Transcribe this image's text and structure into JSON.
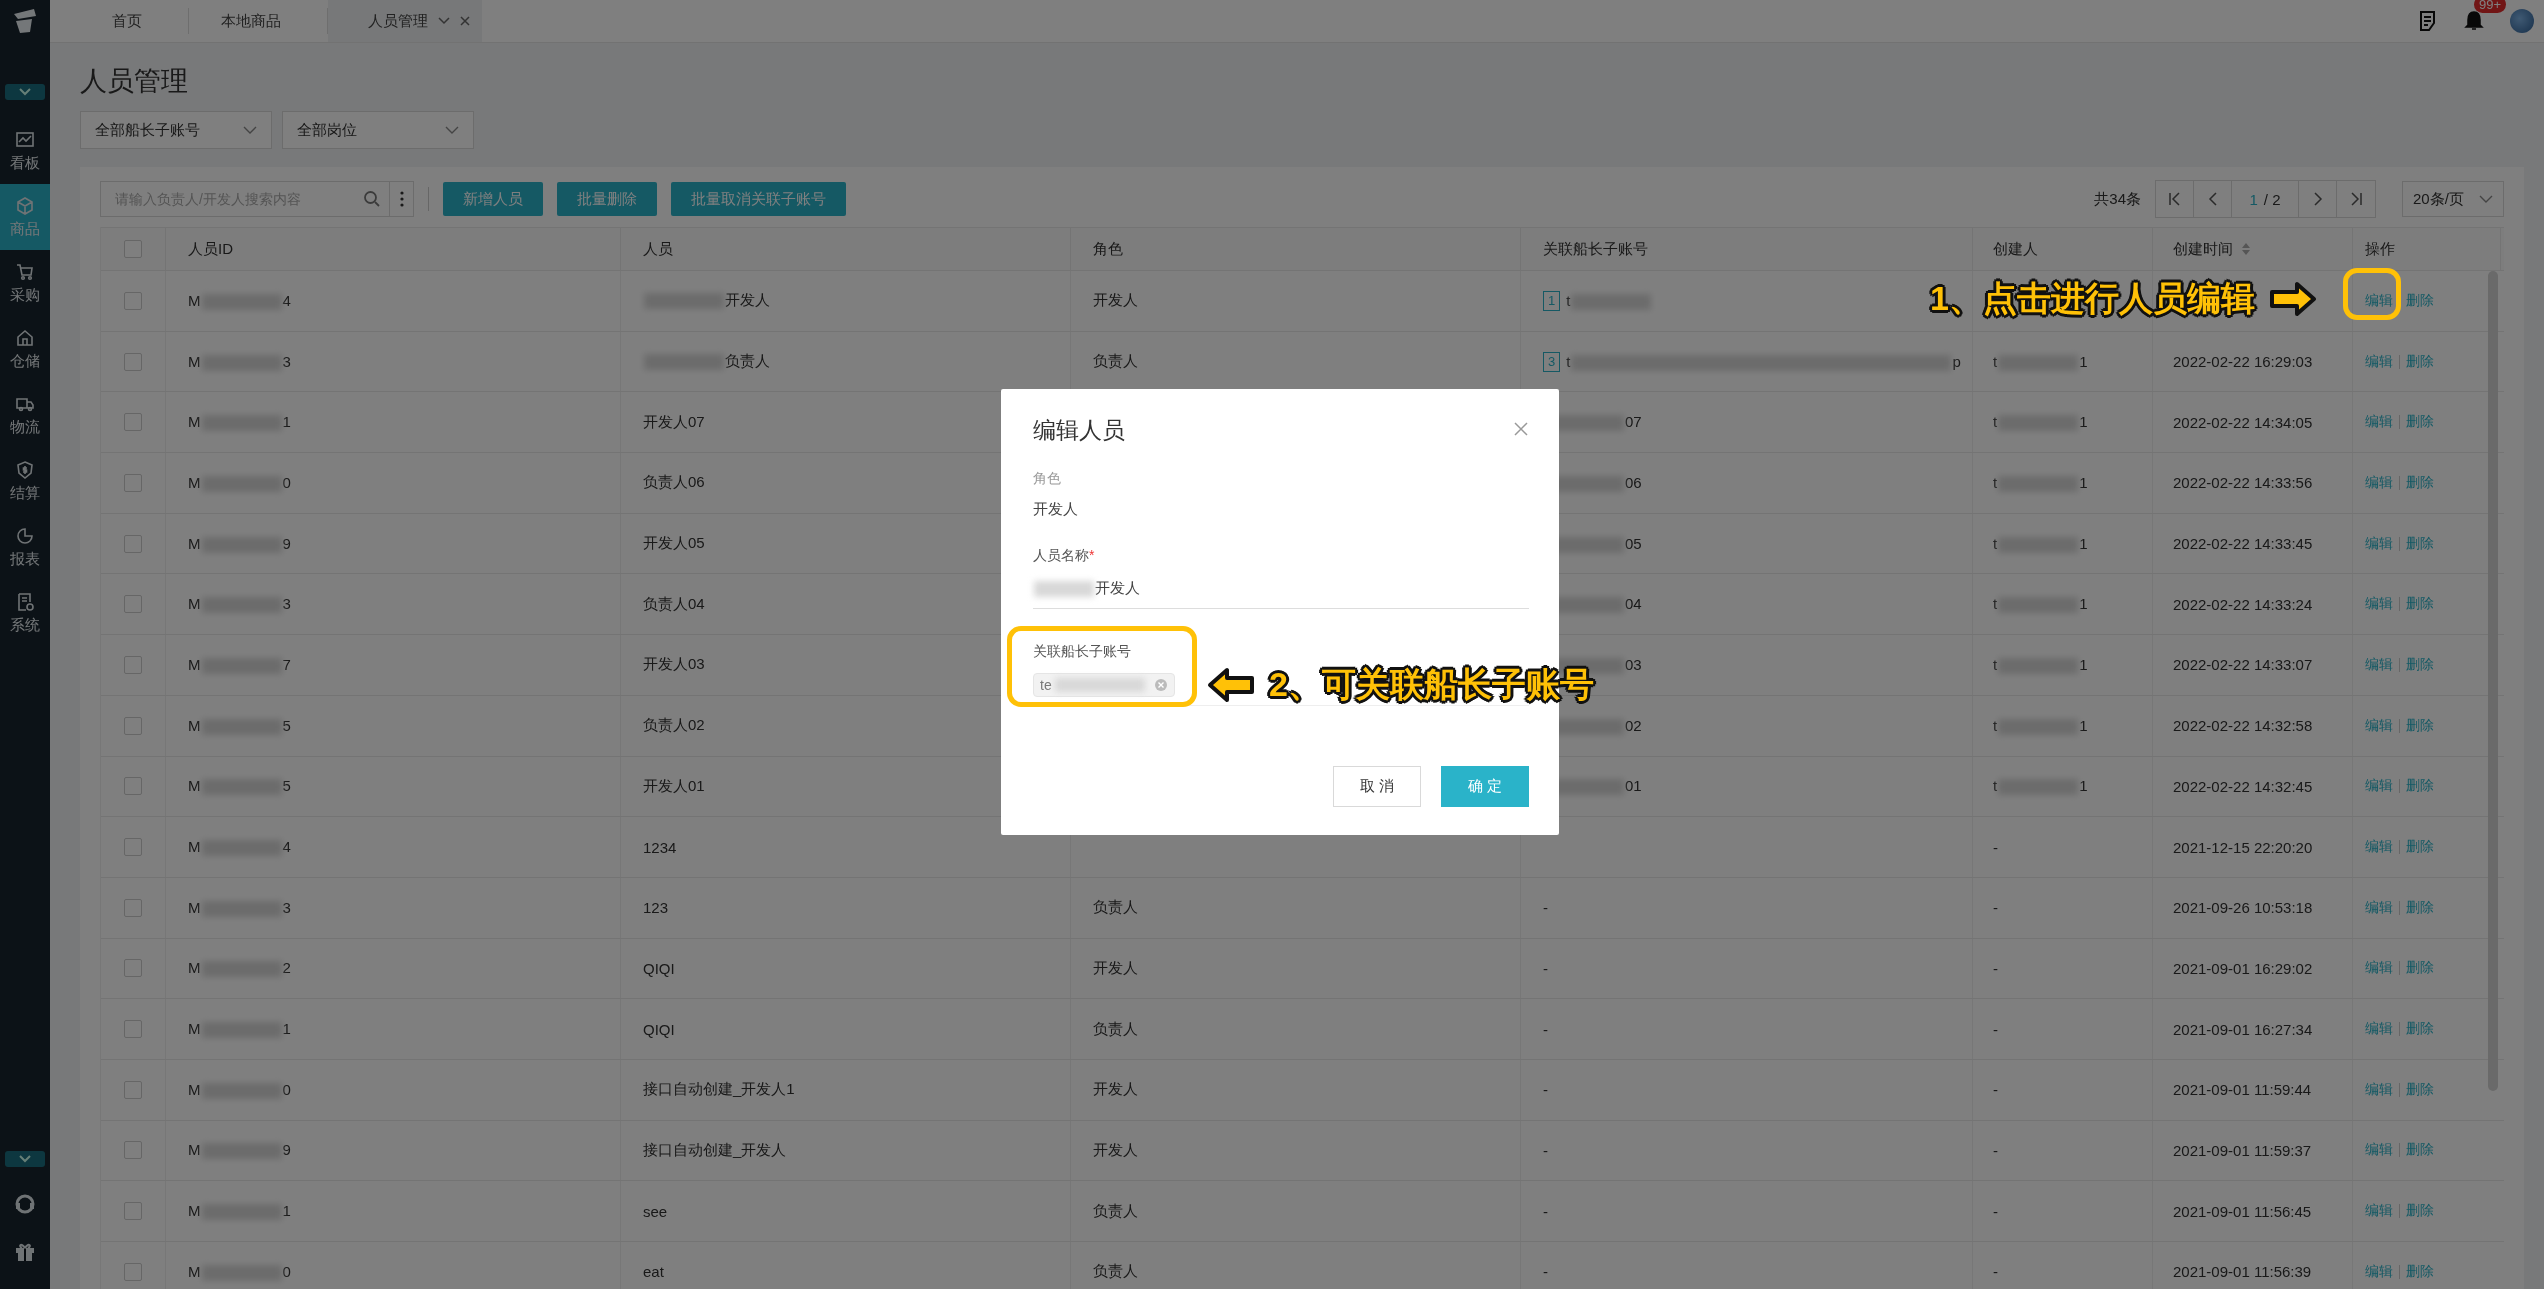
{
  "sidebar": {
    "items": [
      {
        "label": "看板",
        "selected": false
      },
      {
        "label": "商品",
        "selected": true
      },
      {
        "label": "采购",
        "selected": false
      },
      {
        "label": "仓储",
        "selected": false
      },
      {
        "label": "物流",
        "selected": false
      },
      {
        "label": "结算",
        "selected": false
      },
      {
        "label": "报表",
        "selected": false
      },
      {
        "label": "系统",
        "selected": false
      }
    ]
  },
  "tabs": [
    {
      "label": "首页",
      "selected": false
    },
    {
      "label": "本地商品",
      "selected": false
    },
    {
      "label": "人员管理",
      "selected": true
    }
  ],
  "header": {
    "notification_badge": "99+"
  },
  "page_title": "人员管理",
  "filters": [
    {
      "value": "全部船长子账号"
    },
    {
      "value": "全部岗位"
    }
  ],
  "search": {
    "placeholder": "请输入负责人/开发人搜索内容"
  },
  "actions": [
    "新增人员",
    "批量删除",
    "批量取消关联子账号"
  ],
  "pagination": {
    "total": "共34条",
    "current": "1",
    "pages": "/ 2",
    "page_size": "20条/页"
  },
  "table": {
    "select_all": false,
    "columns": [
      {
        "label": "人员ID"
      },
      {
        "label": "人员"
      },
      {
        "label": "角色"
      },
      {
        "label": "关联船长子账号"
      },
      {
        "label": "创建人"
      },
      {
        "label": "创建时间",
        "sortable": true
      },
      {
        "label": "操作"
      }
    ],
    "rows": [
      {
        "checked": false,
        "id": {
          "head": "M",
          "tail": "4"
        },
        "person": {
          "tail": "开发人"
        },
        "role": "开发人",
        "account": {
          "badge": "1",
          "head": "t"
        },
        "creator": null,
        "time": null,
        "actions": [
          "编辑",
          "删除"
        ]
      },
      {
        "checked": false,
        "id": {
          "head": "M",
          "tail": "3"
        },
        "person": {
          "tail": "负责人"
        },
        "role": "负责人",
        "account": {
          "badge": "3",
          "head": "t",
          "tail": "p"
        },
        "creator": {
          "head": "t",
          "tail": "1"
        },
        "time": "2022-02-22 16:29:03",
        "actions": [
          "编辑",
          "删除"
        ]
      },
      {
        "checked": false,
        "id": {
          "head": "M",
          "tail": "1"
        },
        "person": "开发人07",
        "role": null,
        "account": {
          "tail": "07"
        },
        "creator": {
          "head": "t",
          "tail": "1"
        },
        "time": "2022-02-22 14:34:05",
        "actions": [
          "编辑",
          "删除"
        ]
      },
      {
        "checked": false,
        "id": {
          "head": "M",
          "tail": "0"
        },
        "person": "负责人06",
        "role": null,
        "account": {
          "tail": "06"
        },
        "creator": {
          "head": "t",
          "tail": "1"
        },
        "time": "2022-02-22 14:33:56",
        "actions": [
          "编辑",
          "删除"
        ]
      },
      {
        "checked": false,
        "id": {
          "head": "M",
          "tail": "9"
        },
        "person": "开发人05",
        "role": null,
        "account": {
          "tail": "05"
        },
        "creator": {
          "head": "t",
          "tail": "1"
        },
        "time": "2022-02-22 14:33:45",
        "actions": [
          "编辑",
          "删除"
        ]
      },
      {
        "checked": false,
        "id": {
          "head": "M",
          "tail": "3"
        },
        "person": "负责人04",
        "role": null,
        "account": {
          "tail": "04"
        },
        "creator": {
          "head": "t",
          "tail": "1"
        },
        "time": "2022-02-22 14:33:24",
        "actions": [
          "编辑",
          "删除"
        ]
      },
      {
        "checked": false,
        "id": {
          "head": "M",
          "tail": "7"
        },
        "person": "开发人03",
        "role": null,
        "account": {
          "tail": "03"
        },
        "creator": {
          "head": "t",
          "tail": "1"
        },
        "time": "2022-02-22 14:33:07",
        "actions": [
          "编辑",
          "删除"
        ]
      },
      {
        "checked": false,
        "id": {
          "head": "M",
          "tail": "5"
        },
        "person": "负责人02",
        "role": null,
        "account": {
          "tail": "02"
        },
        "creator": {
          "head": "t",
          "tail": "1"
        },
        "time": "2022-02-22 14:32:58",
        "actions": [
          "编辑",
          "删除"
        ]
      },
      {
        "checked": false,
        "id": {
          "head": "M",
          "tail": "5"
        },
        "person": "开发人01",
        "role": null,
        "account": {
          "tail": "01"
        },
        "creator": {
          "head": "t",
          "tail": "1"
        },
        "time": "2022-02-22 14:32:45",
        "actions": [
          "编辑",
          "删除"
        ]
      },
      {
        "checked": false,
        "id": {
          "head": "M",
          "tail": "4"
        },
        "person": "1234",
        "role": null,
        "account": null,
        "creator": "-",
        "time": "2021-12-15 22:20:20",
        "actions": [
          "编辑",
          "删除"
        ]
      },
      {
        "checked": false,
        "id": {
          "head": "M",
          "tail": "3"
        },
        "person": "123",
        "role": "负责人",
        "account": "-",
        "creator": "-",
        "time": "2021-09-26 10:53:18",
        "actions": [
          "编辑",
          "删除"
        ]
      },
      {
        "checked": false,
        "id": {
          "head": "M",
          "tail": "2"
        },
        "person": "QIQI",
        "role": "开发人",
        "account": "-",
        "creator": "-",
        "time": "2021-09-01 16:29:02",
        "actions": [
          "编辑",
          "删除"
        ]
      },
      {
        "checked": false,
        "id": {
          "head": "M",
          "tail": "1"
        },
        "person": "QIQI",
        "role": "负责人",
        "account": "-",
        "creator": "-",
        "time": "2021-09-01 16:27:34",
        "actions": [
          "编辑",
          "删除"
        ]
      },
      {
        "checked": false,
        "id": {
          "head": "M",
          "tail": "0"
        },
        "person": "接口自动创建_开发人1",
        "role": "开发人",
        "account": "-",
        "creator": "-",
        "time": "2021-09-01 11:59:44",
        "actions": [
          "编辑",
          "删除"
        ]
      },
      {
        "checked": false,
        "id": {
          "head": "M",
          "tail": "9"
        },
        "person": "接口自动创建_开发人",
        "role": "开发人",
        "account": "-",
        "creator": "-",
        "time": "2021-09-01 11:59:37",
        "actions": [
          "编辑",
          "删除"
        ]
      },
      {
        "checked": false,
        "id": {
          "head": "M",
          "tail": "1"
        },
        "person": "see",
        "role": "负责人",
        "account": "-",
        "creator": "-",
        "time": "2021-09-01 11:56:45",
        "actions": [
          "编辑",
          "删除"
        ]
      },
      {
        "checked": false,
        "id": {
          "head": "M",
          "tail": "0"
        },
        "person": "eat",
        "role": "负责人",
        "account": "-",
        "creator": "-",
        "time": "2021-09-01 11:56:39",
        "actions": [
          "编辑",
          "删除"
        ]
      }
    ]
  },
  "dialog": {
    "title": "编辑人员",
    "fields": [
      {
        "kind": "static",
        "label": "角色",
        "value": {
          "text": "开发人"
        }
      },
      {
        "kind": "input",
        "label": "人员名称",
        "required_mark": "*",
        "value": {
          "tail": "开发人"
        }
      },
      {
        "kind": "tags",
        "label": "关联船长子账号",
        "tags": [
          {
            "head": "te"
          }
        ]
      }
    ],
    "buttons": [
      {
        "label": "取 消",
        "primary": false
      },
      {
        "label": "确 定",
        "primary": true
      }
    ]
  },
  "annotations": [
    {
      "text": "1、点击进行人员编辑",
      "kind": "right"
    },
    {
      "text": "2、可关联船长子账号",
      "kind": "left"
    }
  ]
}
